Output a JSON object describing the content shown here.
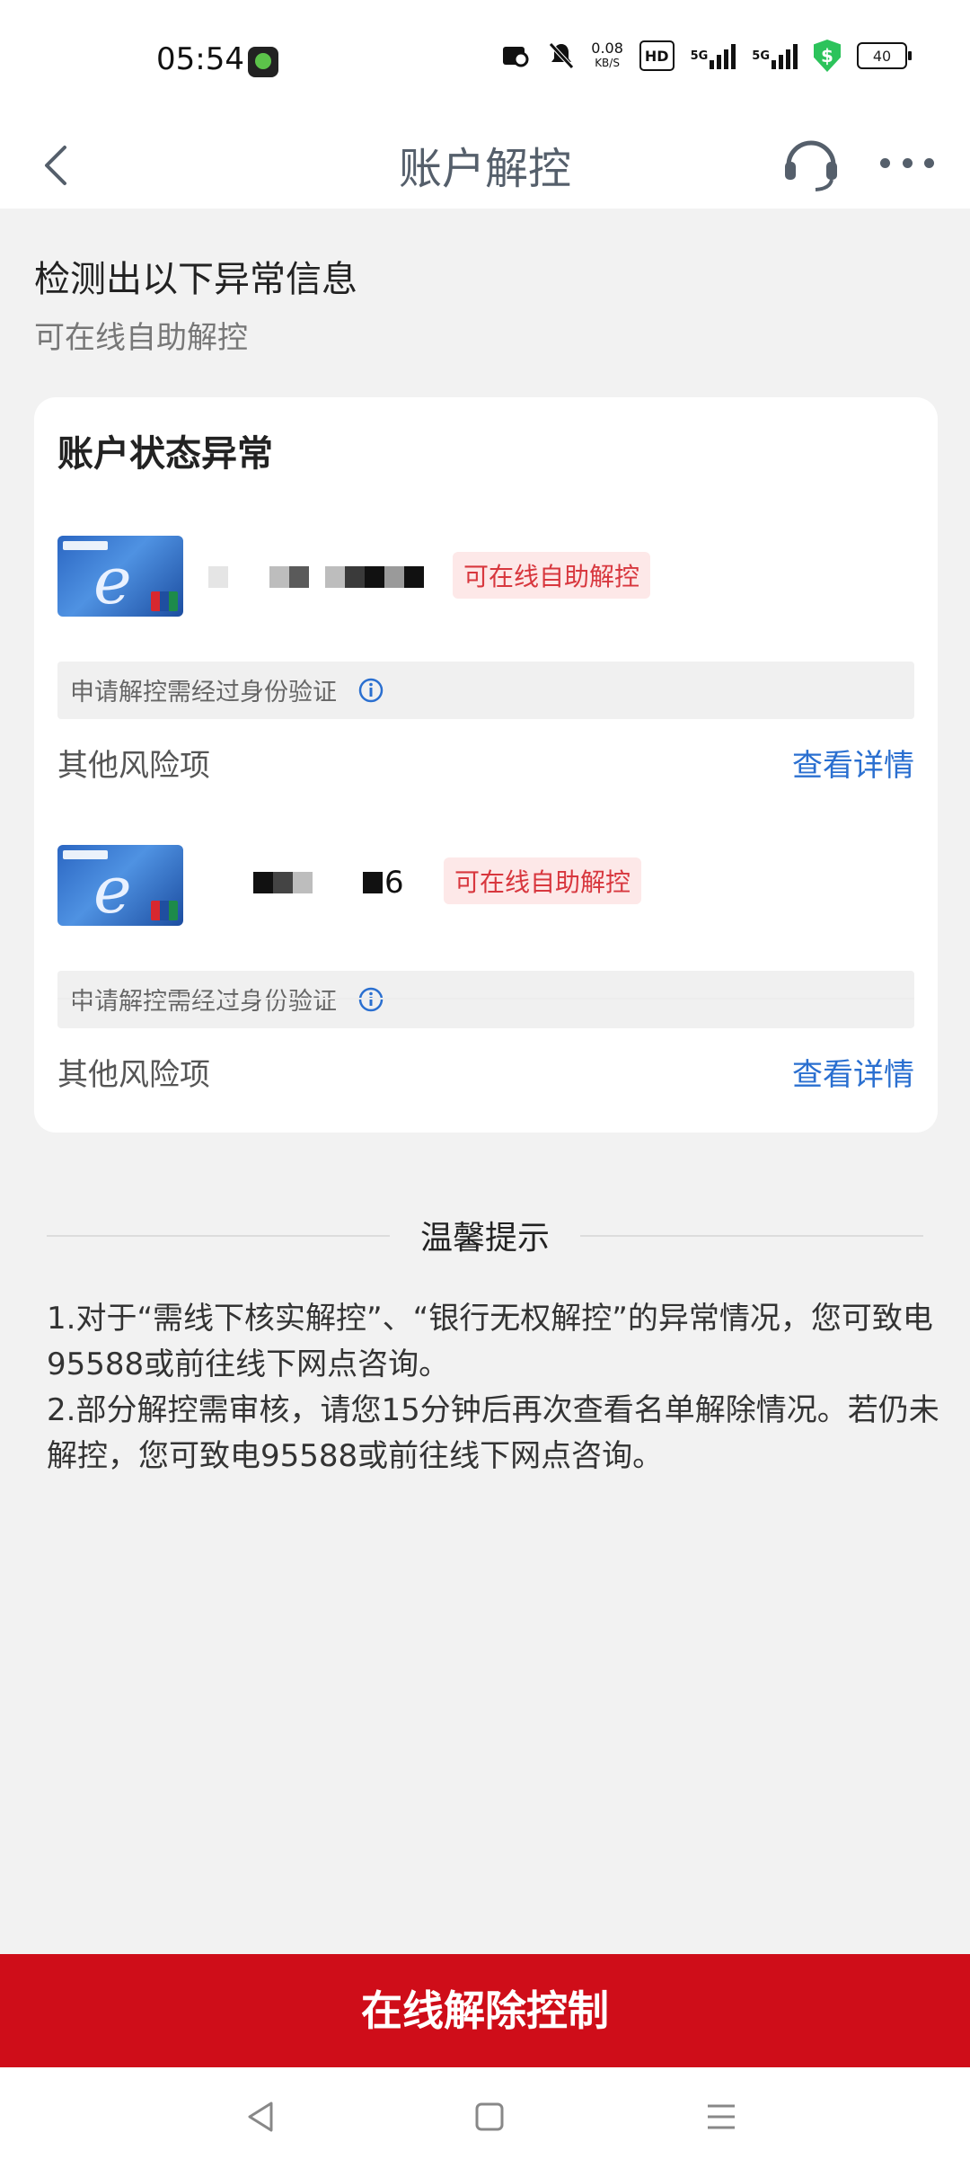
{
  "status": {
    "time": "05:54",
    "net_speed_value": "0.08",
    "net_speed_unit": "KB/S",
    "hd_label": "HD",
    "signal1_label": "5G",
    "signal2_label": "5G",
    "battery": "40",
    "shield_label": "$"
  },
  "nav": {
    "title": "账户解控"
  },
  "header": {
    "title": "检测出以下异常信息",
    "subtitle": "可在线自助解控"
  },
  "card": {
    "title": "账户状态异常",
    "accounts": [
      {
        "badge": "可在线自助解控",
        "verify_text": "申请解控需经过身份验证",
        "risk_label": "其他风险项",
        "detail_link": "查看详情"
      },
      {
        "badge": "可在线自助解控",
        "verify_text": "申请解控需经过身份验证",
        "risk_label": "其他风险项",
        "detail_link": "查看详情",
        "visible_fragment": "6"
      }
    ]
  },
  "tips": {
    "title": "温馨提示",
    "line1": "1.对于“需线下核实解控”、“银行无权解控”的异常情况，您可致电95588或前往线下网点咨询。",
    "line2": "2.部分解控需审核，请您15分钟后再次查看名单解除情况。若仍未解控，您可致电95588或前往线下网点咨询。"
  },
  "bottom_button": "在线解除控制",
  "colors": {
    "brand_red": "#cf0d19",
    "link_blue": "#2a6fd0",
    "badge_bg": "#fde8e8",
    "badge_text": "#d8373e"
  }
}
